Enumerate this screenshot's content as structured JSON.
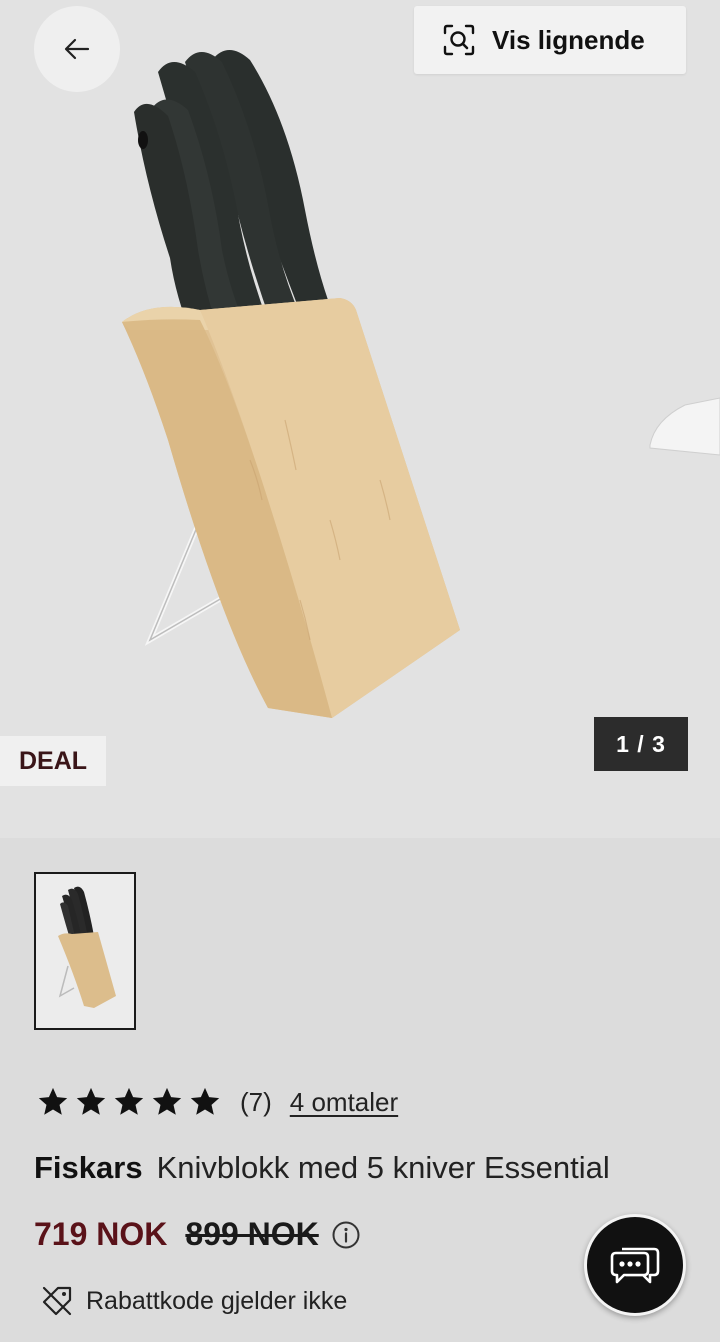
{
  "header": {
    "back_icon": "arrow-left-icon",
    "similar_button_label": "Vis lignende",
    "similar_icon": "visual-search-icon"
  },
  "gallery": {
    "badge": "DEAL",
    "pager": "1 / 3",
    "current_image": 1,
    "total_images": 3
  },
  "rating": {
    "stars": 5,
    "count": "(7)",
    "reviews_link": "4 omtaler"
  },
  "product": {
    "brand": "Fiskars",
    "name": "Knivblokk med 5 kniver Essential"
  },
  "price": {
    "current": "719 NOK",
    "original": "899 NOK",
    "info_icon": "info-circle-icon",
    "current_color": "#5a1219"
  },
  "discount_note": {
    "icon": "tag-off-icon",
    "text": "Rabattkode gjelder ikke"
  },
  "chat": {
    "icon": "chat-bubbles-icon"
  }
}
